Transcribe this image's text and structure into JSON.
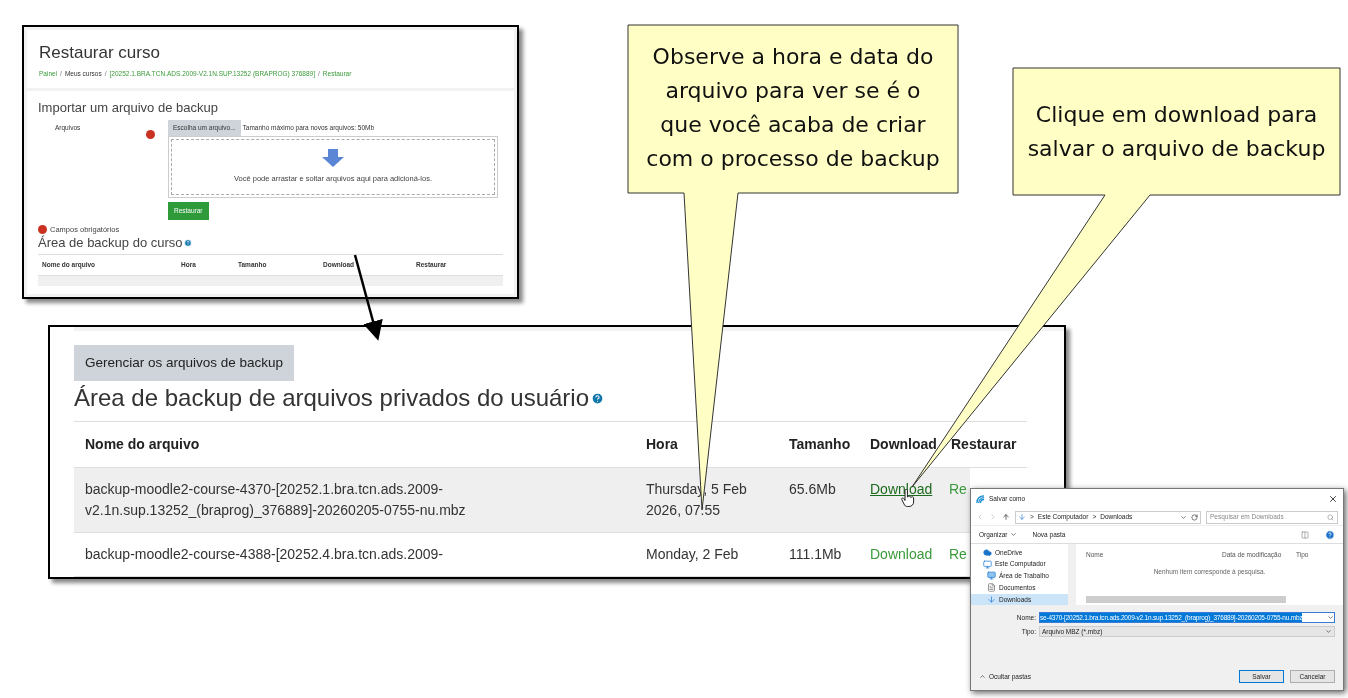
{
  "restore_page": {
    "title": "Restaurar curso",
    "separator": "/",
    "breadcrumb": [
      {
        "label": "Painel",
        "link": true
      },
      {
        "label": "Meus cursos",
        "link": false
      },
      {
        "label": "[20252.1.BRA.TCN.ADS.2009-V2.1N.SUP.13252 (BRAPROG) 376889]",
        "link": true
      },
      {
        "label": "Restaurar",
        "link": true
      }
    ],
    "import_heading": "Importar um arquivo de backup",
    "files_label": "Arquivos",
    "choose_button": "Escolha um arquivo...",
    "max_size": "Tamanho máximo para novos arquivos: 50Mb",
    "drop_text": "Você pode arrastar e soltar arquivos aqui para adicioná-los.",
    "restore_button": "Restaurar",
    "required_note": "Campos obrigatórios",
    "course_area_heading": "Área de backup do curso",
    "columns": [
      "Nome do arquivo",
      "Hora",
      "Tamanho",
      "Download",
      "Restaurar"
    ]
  },
  "backup_page": {
    "manage_button": "Gerenciar os arquivos de backup",
    "heading": "Área de backup de arquivos privados do usuário",
    "columns": [
      "Nome do arquivo",
      "Hora",
      "Tamanho",
      "Download",
      "Restaurar"
    ],
    "rows": [
      {
        "name": [
          "backup-moodle2-course-4370-[20252.1.bra.tcn.ads.2009-",
          "v2.1n.sup.13252_(braprog)_376889]-20260205-0755-nu.mbz"
        ],
        "time": [
          "Thursday, 5 Feb",
          "2026, 07:55"
        ],
        "size": "65.6Mb",
        "download": "Download",
        "hovered": true,
        "restore": "Re"
      },
      {
        "name": [
          "backup-moodle2-course-4388-[20252.4.bra.tcn.ads.2009-"
        ],
        "time": [
          "Monday, 2 Feb"
        ],
        "size": "111.1Mb",
        "download": "Download",
        "hovered": false,
        "restore": "Re"
      }
    ]
  },
  "save_dialog": {
    "title": "Salvar como",
    "path_separator": ">",
    "path": [
      "Este Computador",
      "Downloads"
    ],
    "search_placeholder": "Pesquisar em Downloads",
    "organize": "Organizar",
    "new_folder": "Nova pasta",
    "nav": [
      {
        "label": "OneDrive",
        "selected": false
      },
      {
        "label": "Este Computador",
        "selected": false
      },
      {
        "label": "Área de Trabalho",
        "selected": false
      },
      {
        "label": "Documentos",
        "selected": false
      },
      {
        "label": "Downloads",
        "selected": true
      }
    ],
    "columns": [
      "Nome",
      "Data de modificação",
      "Tipo"
    ],
    "empty_text": "Nenhum item corresponde à pesquisa.",
    "name_label": "Nome:",
    "name_value": "se-4370-[20252.1.bra.tcn.ads.2009-v2.1n.sup.13252_(braprog)_376889]-20260205-0755-nu.mbz",
    "type_label": "Tipo:",
    "type_value": "Arquivo MBZ (*.mbz)",
    "hide_folders": "Ocultar pastas",
    "save": "Salvar",
    "cancel": "Cancelar"
  },
  "callouts": [
    {
      "lines": [
        "Observe a hora e data do",
        "arquivo para ver se é o",
        "que você acaba de criar",
        "com o processo de backup"
      ]
    },
    {
      "lines": [
        "Clique em download para",
        "salvar o arquivo de backup"
      ]
    }
  ]
}
